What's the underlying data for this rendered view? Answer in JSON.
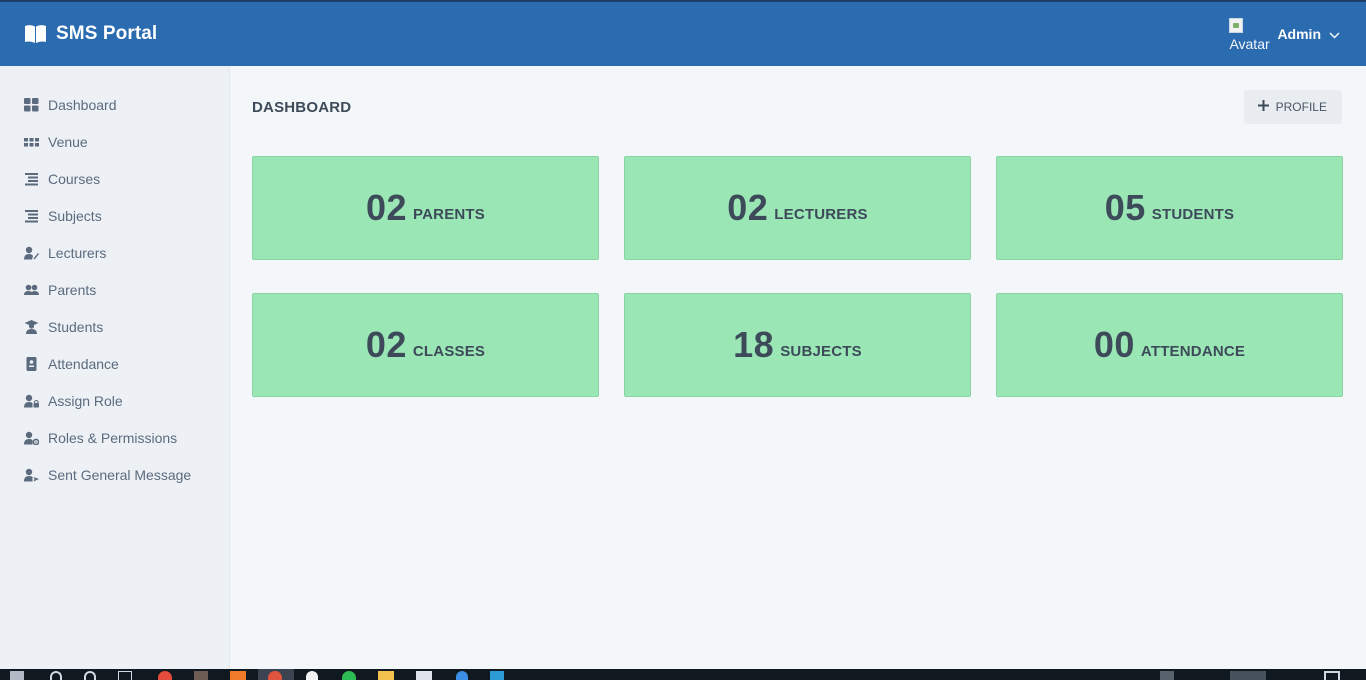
{
  "header": {
    "brand_title": "SMS Portal",
    "brand_icon": "open-book-icon",
    "avatar_alt": "Avatar",
    "user_name": "Admin",
    "dropdown_icon": "chevron-down-icon",
    "bar_color": "#2b6cb0"
  },
  "sidebar": {
    "items": [
      {
        "label": "Dashboard",
        "icon": "grid-icon"
      },
      {
        "label": "Venue",
        "icon": "dots-grid-icon"
      },
      {
        "label": "Courses",
        "icon": "list-icon"
      },
      {
        "label": "Subjects",
        "icon": "list-icon"
      },
      {
        "label": "Lecturers",
        "icon": "user-edit-icon"
      },
      {
        "label": "Parents",
        "icon": "users-icon"
      },
      {
        "label": "Students",
        "icon": "graduate-icon"
      },
      {
        "label": "Attendance",
        "icon": "id-card-icon"
      },
      {
        "label": "Assign Role",
        "icon": "user-lock-icon"
      },
      {
        "label": "Roles & Permissions",
        "icon": "user-cog-icon"
      },
      {
        "label": "Sent General Message",
        "icon": "user-message-icon"
      }
    ]
  },
  "main": {
    "title": "DASHBOARD",
    "profile_button": {
      "label": "PROFILE",
      "icon": "plus-icon"
    },
    "cards": [
      {
        "count": "02",
        "label": "PARENTS"
      },
      {
        "count": "02",
        "label": "LECTURERS"
      },
      {
        "count": "05",
        "label": "STUDENTS"
      },
      {
        "count": "02",
        "label": "CLASSES"
      },
      {
        "count": "18",
        "label": "SUBJECTS"
      },
      {
        "count": "00",
        "label": "ATTENDANCE"
      }
    ],
    "card_color": "#9ae6b4"
  }
}
